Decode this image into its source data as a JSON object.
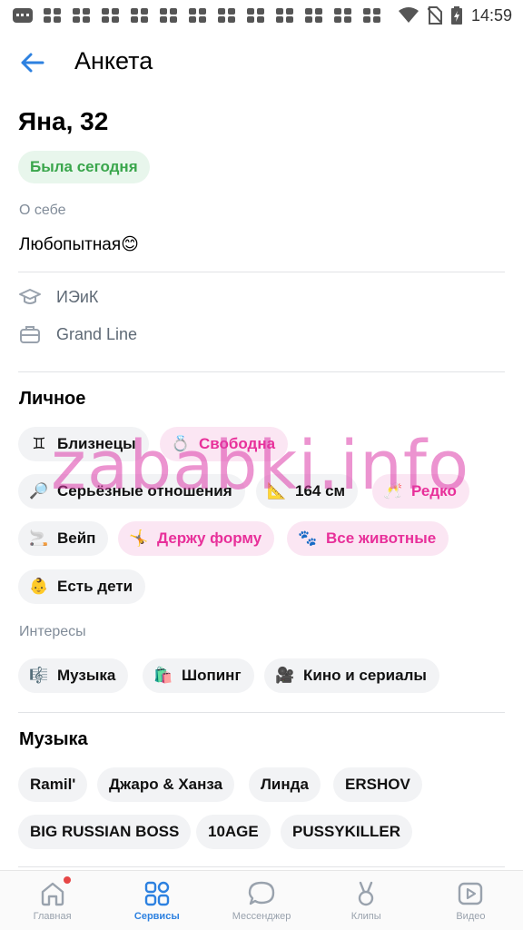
{
  "status_bar": {
    "time": "14:59"
  },
  "header": {
    "title": "Анкета"
  },
  "profile": {
    "name": "Яна, 32",
    "online": "Была сегодня",
    "about_caption": "О себе",
    "about_text": "Любопытная😊",
    "education": "ИЭиК",
    "work": "Grand Line"
  },
  "personal": {
    "title": "Личное",
    "chips": [
      {
        "emoji": "♊",
        "label": "Близнецы",
        "highlight": false
      },
      {
        "emoji": "💍",
        "label": "Свободна",
        "highlight": true
      },
      {
        "emoji": "🔎",
        "label": "Серьёзные отношения",
        "highlight": false
      },
      {
        "emoji": "📐",
        "label": "164 см",
        "highlight": false
      },
      {
        "emoji": "🥂",
        "label": "Редко",
        "highlight": true
      },
      {
        "emoji": "🚬",
        "label": "Вейп",
        "highlight": false
      },
      {
        "emoji": "🤸",
        "label": "Держу форму",
        "highlight": true
      },
      {
        "emoji": "🐾",
        "label": "Все животные",
        "highlight": true
      },
      {
        "emoji": "👶",
        "label": "Есть дети",
        "highlight": false
      }
    ]
  },
  "interests": {
    "caption": "Интересы",
    "chips": [
      {
        "emoji": "🎼",
        "label": "Музыка"
      },
      {
        "emoji": "🛍️",
        "label": "Шопинг"
      },
      {
        "emoji": "🎥",
        "label": "Кино и сериалы"
      }
    ]
  },
  "music": {
    "title": "Музыка",
    "artists": [
      "Ramil'",
      "Джаро & Ханза",
      "Линда",
      "ERSHOV",
      "BIG RUSSIAN BOSS",
      "10AGE",
      "PUSSYKILLER"
    ]
  },
  "watermark": "zababki.info",
  "tabbar": {
    "items": [
      {
        "label": "Главная",
        "icon": "home-icon"
      },
      {
        "label": "Сервисы",
        "icon": "services-icon"
      },
      {
        "label": "Мессенджер",
        "icon": "messenger-icon"
      },
      {
        "label": "Клипы",
        "icon": "clips-icon"
      },
      {
        "label": "Видео",
        "icon": "video-icon"
      }
    ],
    "active": "Сервисы"
  },
  "colors": {
    "accent": "#2d81e0",
    "online": "#3aa64c",
    "highlight": "#e8309a"
  }
}
